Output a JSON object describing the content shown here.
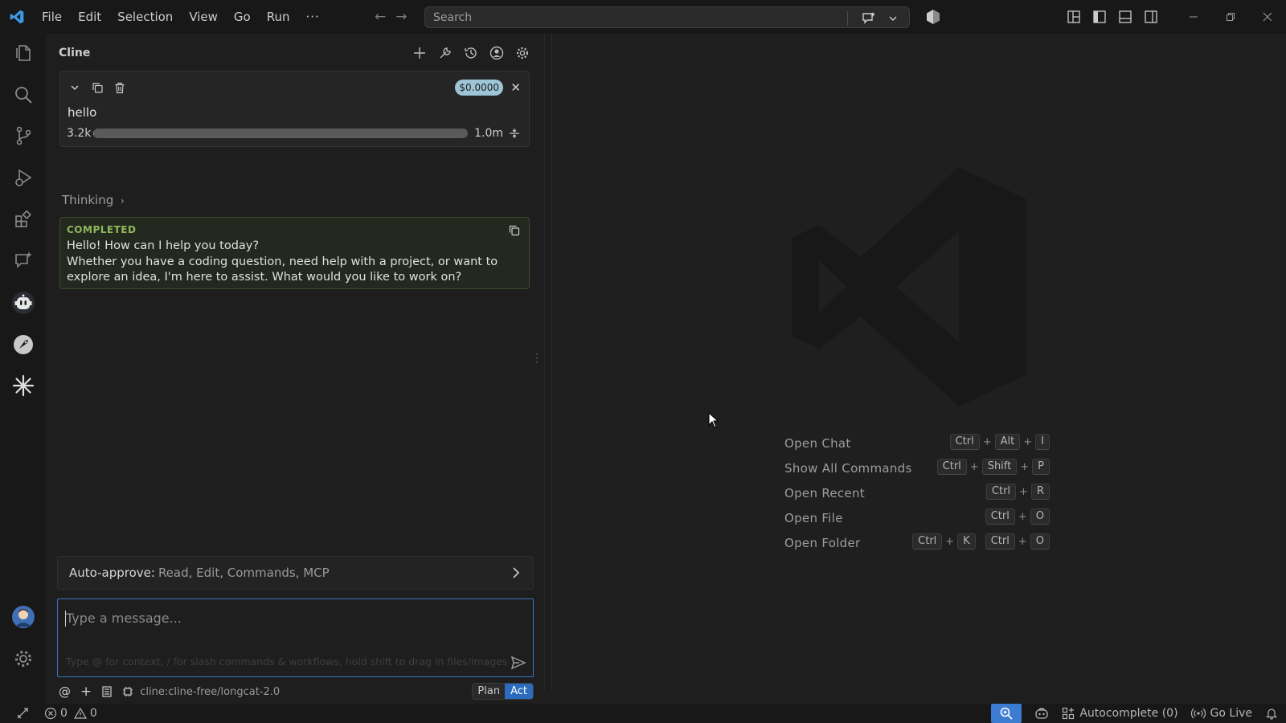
{
  "titlebar": {
    "menu": [
      "File",
      "Edit",
      "Selection",
      "View",
      "Go",
      "Run",
      "···"
    ],
    "search_placeholder": "Search"
  },
  "activity_bar": {
    "icons": [
      "files-icon",
      "search-icon",
      "source-control-icon",
      "run-debug-icon",
      "extensions-icon",
      "chat-sparkle-icon",
      "cline-robot-icon",
      "rocket-icon",
      "asterisk-icon",
      "account-avatar-icon",
      "settings-gear-icon"
    ]
  },
  "cline": {
    "title": "Cline",
    "task": {
      "cost": "$0.0000",
      "text": "hello",
      "context_used": "3.2k",
      "context_max": "1.0m",
      "context_fraction": 0.003
    },
    "thinking_label": "Thinking",
    "completed": {
      "label": "COMPLETED",
      "line1": "Hello! How can I help you today?",
      "line2": "Whether you have a coding question, need help with a project, or want to explore an idea, I'm here to assist. What would you like to work on?"
    },
    "auto_approve": {
      "label": "Auto-approve:",
      "values": "Read, Edit, Commands, MCP"
    },
    "input": {
      "placeholder": "Type a message...",
      "hint": "Type @ for context, / for slash commands & workflows, hold shift to drag in files/images"
    },
    "model": "cline:cline-free/longcat-2.0",
    "modes": {
      "plan": "Plan",
      "act": "Act",
      "active": "Act"
    }
  },
  "editor": {
    "shortcuts": [
      {
        "label": "Open Chat",
        "keys": [
          [
            "Ctrl",
            "Alt",
            "I"
          ]
        ]
      },
      {
        "label": "Show All Commands",
        "keys": [
          [
            "Ctrl",
            "Shift",
            "P"
          ]
        ]
      },
      {
        "label": "Open Recent",
        "keys": [
          [
            "Ctrl",
            "R"
          ]
        ]
      },
      {
        "label": "Open File",
        "keys": [
          [
            "Ctrl",
            "O"
          ]
        ]
      },
      {
        "label": "Open Folder",
        "keys": [
          [
            "Ctrl",
            "K"
          ],
          [
            "Ctrl",
            "O"
          ]
        ]
      }
    ]
  },
  "statusbar": {
    "errors": "0",
    "warnings": "0",
    "autocomplete": "Autocomplete (0)",
    "go_live": "Go Live"
  },
  "colors": {
    "accent": "#3b7bd2",
    "act_button": "#2c6cbf",
    "completed_label": "#8fb85a",
    "cost_badge": "#9ec5d6"
  }
}
